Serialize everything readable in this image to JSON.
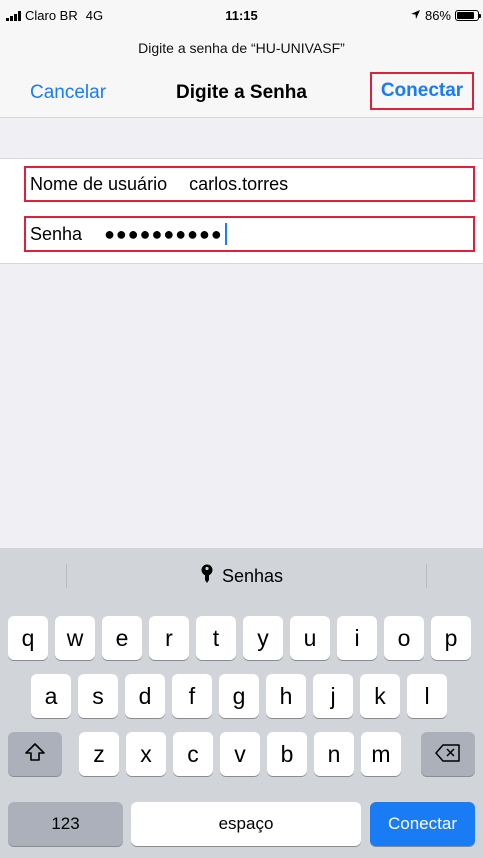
{
  "status": {
    "carrier": "Claro BR",
    "network": "4G",
    "time": "11:15",
    "battery": "86%",
    "battery_level": 0.86
  },
  "nav": {
    "prompt": "Digite a senha de “HU-UNIVASF”",
    "cancel": "Cancelar",
    "title": "Digite a Senha",
    "connect": "Conectar"
  },
  "form": {
    "username_label": "Nome de usuário",
    "username_value": "carlos.torres",
    "password_label": "Senha",
    "password_dots": "●●●●●●●●●●"
  },
  "keyboard": {
    "suggestion": "Senhas",
    "row1": [
      "q",
      "w",
      "e",
      "r",
      "t",
      "y",
      "u",
      "i",
      "o",
      "p"
    ],
    "row2": [
      "a",
      "s",
      "d",
      "f",
      "g",
      "h",
      "j",
      "k",
      "l"
    ],
    "row3": [
      "z",
      "x",
      "c",
      "v",
      "b",
      "n",
      "m"
    ],
    "numbers": "123",
    "space": "espaço",
    "action": "Conectar"
  },
  "colors": {
    "accent": "#1a7cf4",
    "highlight": "#e0203a"
  }
}
